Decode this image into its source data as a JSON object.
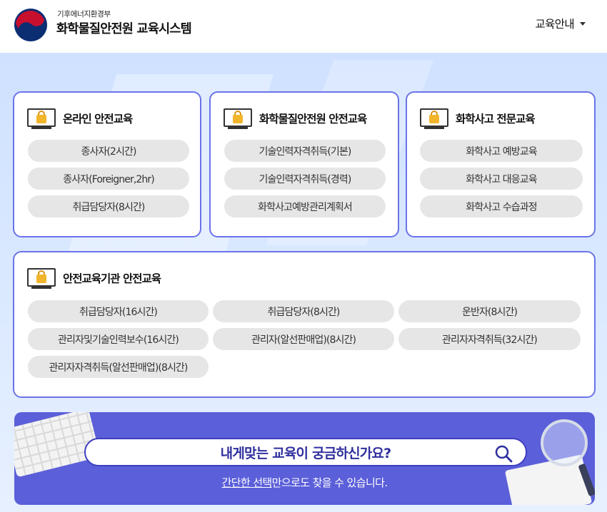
{
  "header": {
    "org_small": "기후에너지환경부",
    "org_title": "화학물질안전원 교육시스템",
    "menu_label": "교육안내"
  },
  "cards": {
    "online": {
      "title": "온라인 안전교육",
      "items": [
        "종사자(2시간)",
        "종사자(Foreigner,2hr)",
        "취급담당자(8시간)"
      ]
    },
    "nics": {
      "title": "화학물질안전원 안전교육",
      "items": [
        "기술인력자격취득(기본)",
        "기술인력자격취득(경력)",
        "화학사고예방관리계획서"
      ]
    },
    "accident": {
      "title": "화학사고 전문교육",
      "items": [
        "화학사고 예방교육",
        "화학사고 대응교육",
        "화학사고 수습과정"
      ]
    },
    "institution": {
      "title": "안전교육기관 안전교육",
      "items": [
        "취급담당자(16시간)",
        "취급담당자(8시간)",
        "운반자(8시간)",
        "관리자및기술인력보수(16시간)",
        "관리자(알선판매업)(8시간)",
        "관리자자격취득(32시간)",
        "관리자자격취득(알선판매업)(8시간)"
      ]
    }
  },
  "banner": {
    "search_text": "내게맞는 교육이 궁금하신가요?",
    "sub_underlined": "간단한 선택",
    "sub_rest": "만으로도 찾을 수 있습니다."
  },
  "colors": {
    "card_border": "#6b73e8",
    "banner_bg": "#5b5fd9",
    "pill_bg": "#e6e6e6",
    "lock": "#f1b52b"
  }
}
